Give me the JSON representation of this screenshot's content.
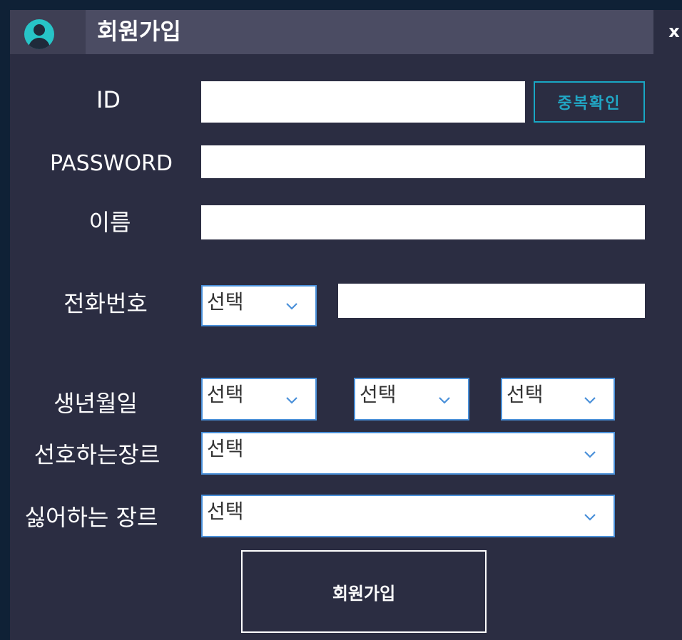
{
  "window": {
    "title": "회원가입",
    "close_label": "x"
  },
  "form": {
    "id_label": "ID",
    "id_value": "",
    "dup_check_label": "중복확인",
    "password_label": "PASSWORD",
    "password_value": "",
    "name_label": "이름",
    "name_value": "",
    "phone_label": "전화번호",
    "phone_prefix_select": "선택",
    "phone_value": "",
    "birth_label": "생년월일",
    "birth_year_select": "선택",
    "birth_month_select": "선택",
    "birth_day_select": "선택",
    "liked_genre_label": "선호하는장르",
    "liked_genre_select": "선택",
    "disliked_genre_label": "싫어하는 장르",
    "disliked_genre_select": "선택",
    "submit_label": "회원가입"
  },
  "icons": {
    "avatar": "user-avatar-icon",
    "dropdown": "chevron-down-icon",
    "close": "close-icon"
  },
  "colors": {
    "background": "#2b2d42",
    "titlebar": "#4b4c63",
    "accent": "#19a7c4",
    "select_border": "#4a90d9"
  }
}
